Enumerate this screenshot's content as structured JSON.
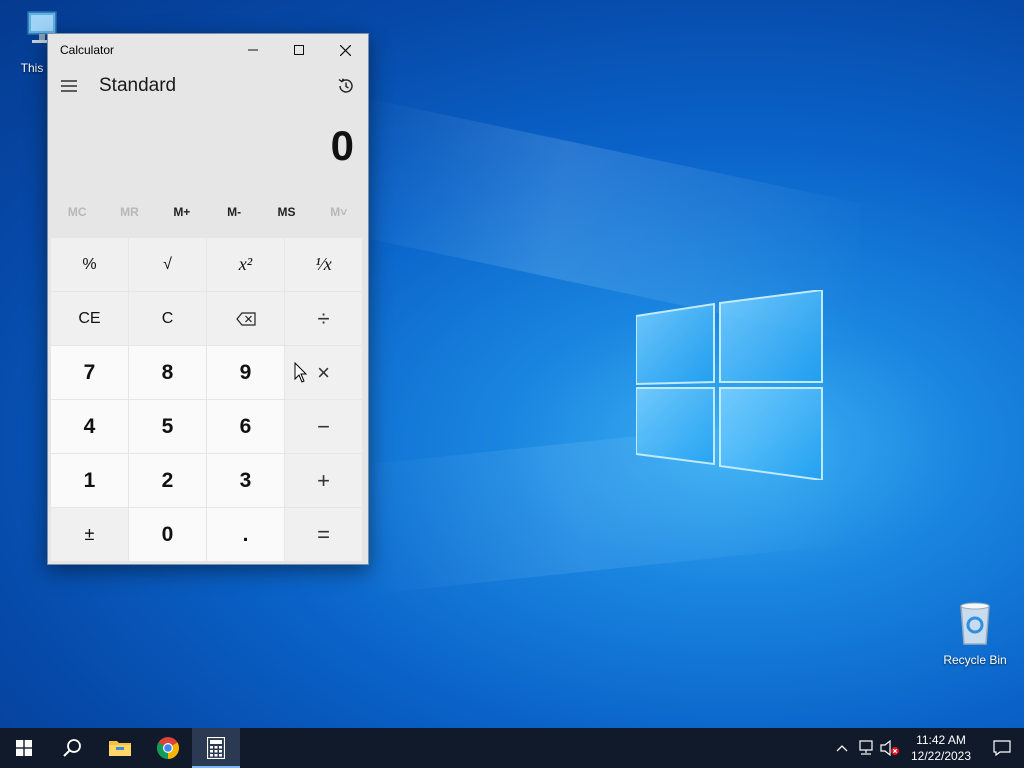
{
  "desktop": {
    "icons": [
      {
        "label": "This PC",
        "icon": "this-pc-icon"
      },
      {
        "label": "Recycle Bin",
        "icon": "recycle-bin-icon"
      }
    ]
  },
  "calculator": {
    "window_title": "Calculator",
    "mode": "Standard",
    "display_value": "0",
    "memory_buttons": [
      {
        "label": "MC",
        "enabled": false
      },
      {
        "label": "MR",
        "enabled": false
      },
      {
        "label": "M+",
        "enabled": true
      },
      {
        "label": "M-",
        "enabled": true
      },
      {
        "label": "MS",
        "enabled": true
      },
      {
        "label": "M˅",
        "enabled": false
      }
    ],
    "keys": {
      "percent": "%",
      "sqrt": "√",
      "square": "x²",
      "reciprocal": "¹⁄x",
      "ce": "CE",
      "c": "C",
      "backspace": "⌫",
      "divide": "÷",
      "seven": "7",
      "eight": "8",
      "nine": "9",
      "multiply": "×",
      "four": "4",
      "five": "5",
      "six": "6",
      "minus": "−",
      "one": "1",
      "two": "2",
      "three": "3",
      "plus": "+",
      "negate": "±",
      "zero": "0",
      "decimal": ".",
      "equals": "="
    }
  },
  "taskbar": {
    "apps": [
      "start-icon",
      "search-icon",
      "file-explorer-icon",
      "chrome-icon",
      "calculator-icon"
    ],
    "clock_time": "11:42 AM",
    "clock_date": "12/22/2023"
  },
  "colors": {
    "accent": "#0078d7",
    "taskbar": "#101a2a",
    "calc_bg": "#e6e6e6"
  }
}
